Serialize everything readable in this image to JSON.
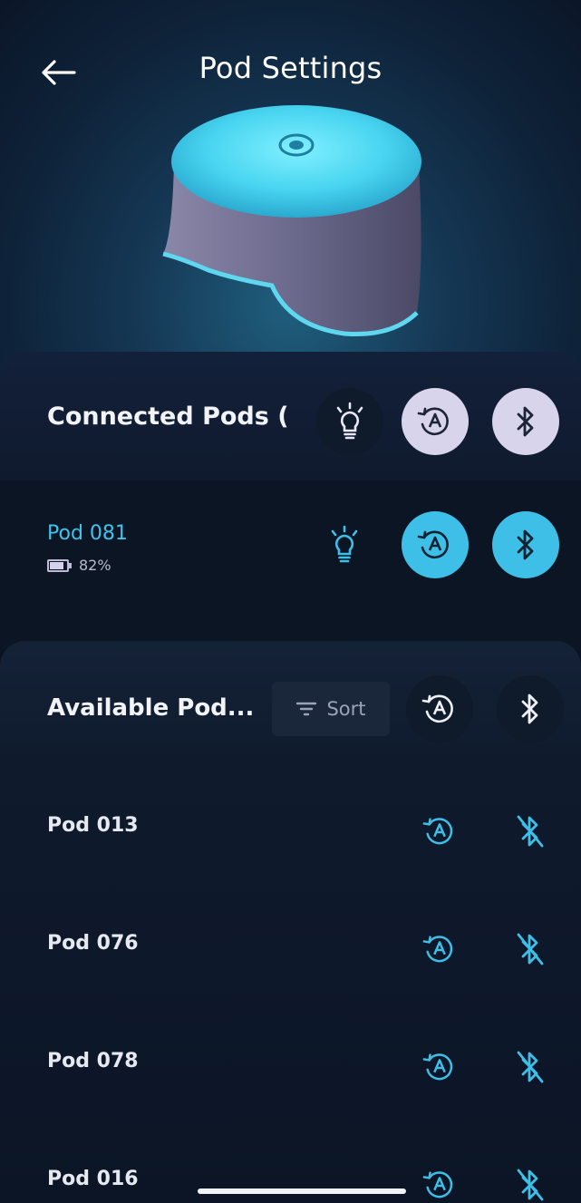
{
  "header": {
    "title": "Pod Settings",
    "back_icon": "arrow-left-icon"
  },
  "colors": {
    "accent": "#3dbfe7",
    "background": "#0a1322",
    "pill_light": "#d8d4ec"
  },
  "connected": {
    "title": "Connected Pods (",
    "icons": [
      "lightbulb-icon",
      "auto-rotate-icon",
      "bluetooth-icon"
    ],
    "pods": [
      {
        "name": "Pod 081",
        "battery_text": "82%",
        "battery_level": 0.82
      }
    ]
  },
  "available": {
    "title": "Available Pod...",
    "sort_label": "Sort",
    "pods": [
      {
        "name": "Pod 013"
      },
      {
        "name": "Pod 076"
      },
      {
        "name": "Pod 078"
      },
      {
        "name": "Pod 016"
      }
    ]
  }
}
